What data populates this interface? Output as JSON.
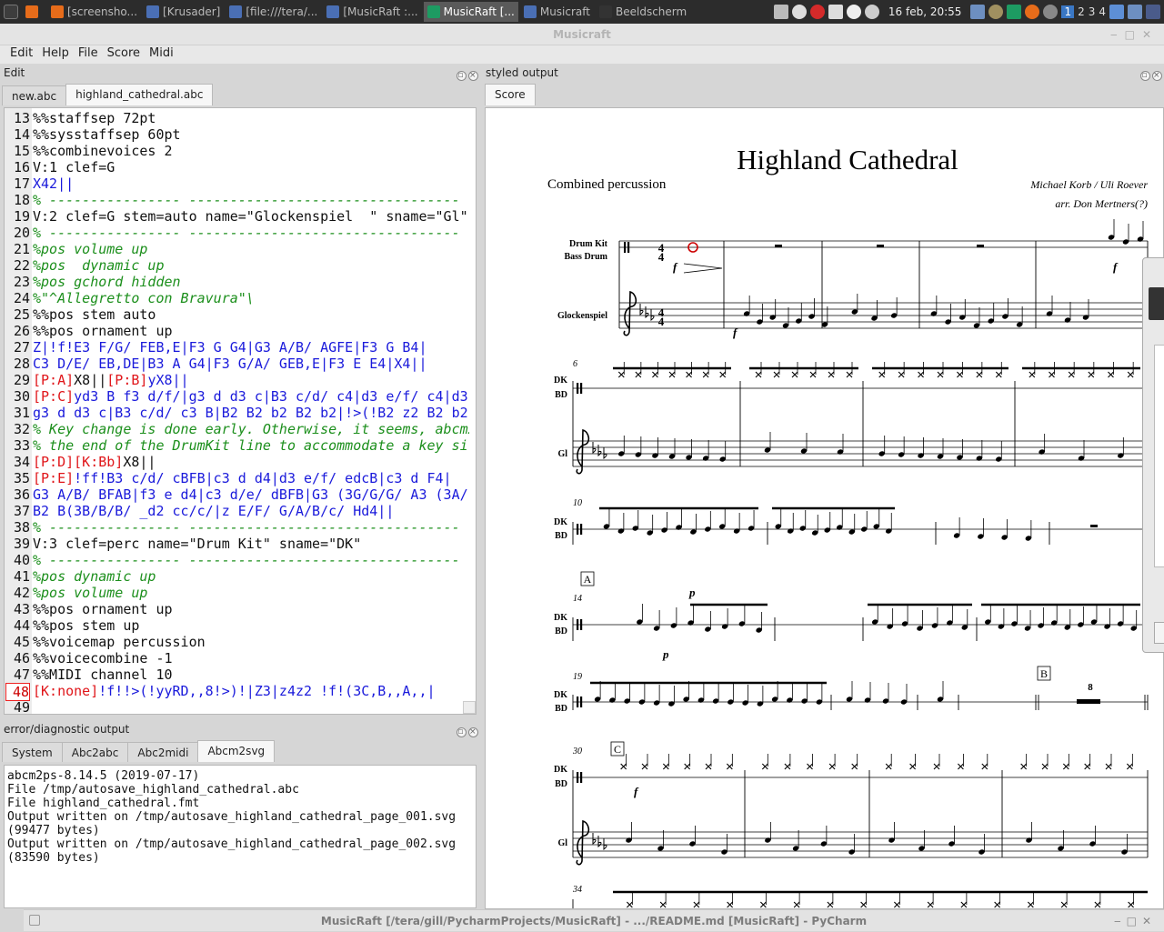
{
  "taskbar": {
    "tasks": [
      {
        "label": "",
        "color": "#e76c1a"
      },
      {
        "label": "[screensho...",
        "color": "#e76c1a"
      },
      {
        "label": "[Krusader]",
        "color": "#4a6fb5"
      },
      {
        "label": "[file:///tera/...",
        "color": "#4a6fb5"
      },
      {
        "label": "[MusicRaft :...",
        "color": "#4a6fb5"
      },
      {
        "label": "MusicRaft [...",
        "color": "#1d9b62",
        "active": true
      },
      {
        "label": "Musicraft",
        "color": "#4a6fb5"
      },
      {
        "label": "Beeldscherm",
        "color": "#333333"
      }
    ],
    "clock": "16 feb, 20:55",
    "workspaces": [
      "1",
      "2",
      "3",
      "4"
    ]
  },
  "window": {
    "title": "Musicraft"
  },
  "menu": [
    "Edit",
    "Help",
    "File",
    "Score",
    "Midi"
  ],
  "edit_dock": {
    "title": "Edit",
    "tabs": [
      "new.abc",
      "highland_cathedral.abc"
    ],
    "active_tab": 1,
    "current_line": "48",
    "lines": [
      {
        "n": "13",
        "segs": [
          {
            "t": "%%staffsep 72pt",
            "c": "plain"
          }
        ]
      },
      {
        "n": "14",
        "segs": [
          {
            "t": "%%sysstaffsep 60pt",
            "c": "plain"
          }
        ]
      },
      {
        "n": "15",
        "segs": [
          {
            "t": "%%combinevoices 2",
            "c": "plain"
          }
        ]
      },
      {
        "n": "16",
        "segs": [
          {
            "t": "V:1 clef=G",
            "c": "plain"
          }
        ]
      },
      {
        "n": "17",
        "segs": [
          {
            "t": "X42||",
            "c": "bar"
          }
        ]
      },
      {
        "n": "18",
        "segs": [
          {
            "t": "% ---------------- ---------------------------------",
            "c": "comment"
          }
        ]
      },
      {
        "n": "19",
        "segs": [
          {
            "t": "V:2 clef=G stem=auto name=\"Glockenspiel  \" sname=\"Gl\"",
            "c": "plain"
          }
        ]
      },
      {
        "n": "20",
        "segs": [
          {
            "t": "% ---------------- ---------------------------------",
            "c": "comment"
          }
        ]
      },
      {
        "n": "21",
        "segs": [
          {
            "t": "%pos volume up",
            "c": "comment"
          }
        ]
      },
      {
        "n": "22",
        "segs": [
          {
            "t": "%pos  dynamic up",
            "c": "comment"
          }
        ]
      },
      {
        "n": "23",
        "segs": [
          {
            "t": "%pos gchord hidden",
            "c": "comment"
          }
        ]
      },
      {
        "n": "24",
        "segs": [
          {
            "t": "%\"^Allegretto con Bravura\"\\",
            "c": "comment"
          }
        ]
      },
      {
        "n": "25",
        "segs": [
          {
            "t": "%%pos stem auto",
            "c": "plain"
          }
        ]
      },
      {
        "n": "26",
        "segs": [
          {
            "t": "%%pos ornament up",
            "c": "plain"
          }
        ]
      },
      {
        "n": "27",
        "segs": [
          {
            "t": "Z|!f!E3 F/G/ FEB,E|F3 G G4|G3 A/B/ AGFE|F3 G B4|",
            "c": "mixed"
          }
        ]
      },
      {
        "n": "28",
        "segs": [
          {
            "t": "C3 D/E/ EB,DE|B3 A G4|F3 G/A/ GEB,E|F3 E E4|X4||",
            "c": "mixed"
          }
        ]
      },
      {
        "n": "29",
        "segs": [
          {
            "t": "[P:A]",
            "c": "red"
          },
          {
            "t": "X8||",
            "c": "plain"
          },
          {
            "t": "[P:B]",
            "c": "red"
          },
          {
            "t": "yX8||",
            "c": "bar"
          }
        ]
      },
      {
        "n": "30",
        "segs": [
          {
            "t": "[P:C]",
            "c": "red"
          },
          {
            "t": "yd3 B f3 d/f/|g3 d d3 c|B3 c/d/ c4|d3 e/f/ c4|d3",
            "c": "mixed"
          }
        ]
      },
      {
        "n": "31",
        "segs": [
          {
            "t": "g3 d d3 c|B3 c/d/ c3 B|B2 B2 b2 B2 b2|!>(!B2 z2 B2 b2!>)",
            "c": "mixed"
          }
        ]
      },
      {
        "n": "32",
        "segs": [
          {
            "t": "% Key change is done early. Otherwise, it seems, abcm2",
            "c": "comment"
          }
        ]
      },
      {
        "n": "33",
        "segs": [
          {
            "t": "% the end of the DrumKit line to accommodate a key si",
            "c": "comment"
          }
        ]
      },
      {
        "n": "34",
        "segs": [
          {
            "t": "[P:D][K:Bb]",
            "c": "red"
          },
          {
            "t": "X8||",
            "c": "plain"
          }
        ]
      },
      {
        "n": "35",
        "segs": [
          {
            "t": "[P:E]",
            "c": "red"
          },
          {
            "t": "!ff!B3 c/d/ cBFB|c3 d d4|d3 e/f/ edcB|c3 d F4|",
            "c": "mixed"
          }
        ]
      },
      {
        "n": "36",
        "segs": [
          {
            "t": "G3 A/B/ BFAB|f3 e d4|c3 d/e/ dBFB|G3 (3G/G/G/ A3 (3A/",
            "c": "mixed"
          }
        ]
      },
      {
        "n": "37",
        "segs": [
          {
            "t": "B2 B(3B/B/B/ _d2 cc/c/|z E/F/ G/A/B/c/ Hd4||",
            "c": "mixed"
          }
        ]
      },
      {
        "n": "38",
        "segs": [
          {
            "t": "% ---------------- ---------------------------------",
            "c": "comment"
          }
        ]
      },
      {
        "n": "39",
        "segs": [
          {
            "t": "V:3 clef=perc name=\"Drum Kit\" sname=\"DK\"",
            "c": "plain"
          }
        ]
      },
      {
        "n": "40",
        "segs": [
          {
            "t": "% ---------------- ---------------------------------",
            "c": "comment"
          }
        ]
      },
      {
        "n": "41",
        "segs": [
          {
            "t": "%pos dynamic up",
            "c": "comment"
          }
        ]
      },
      {
        "n": "42",
        "segs": [
          {
            "t": "%pos volume up",
            "c": "comment"
          }
        ]
      },
      {
        "n": "43",
        "segs": [
          {
            "t": "%%pos ornament up",
            "c": "plain"
          }
        ]
      },
      {
        "n": "44",
        "segs": [
          {
            "t": "%%pos stem up",
            "c": "plain"
          }
        ]
      },
      {
        "n": "45",
        "segs": [
          {
            "t": "%%voicemap percussion",
            "c": "plain"
          }
        ]
      },
      {
        "n": "46",
        "segs": [
          {
            "t": "%%voicecombine -1",
            "c": "plain"
          }
        ]
      },
      {
        "n": "47",
        "segs": [
          {
            "t": "%%MIDI channel 10",
            "c": "plain"
          }
        ]
      },
      {
        "n": "48",
        "segs": [
          {
            "t": "[K:none]",
            "c": "red"
          },
          {
            "t": "!f!!>(!yyRD,,8!>)!|Z3|z4z2 !f!(3C,B,,A,,|",
            "c": "mixed"
          }
        ]
      },
      {
        "n": "49",
        "segs": [
          {
            "t": "",
            "c": "plain"
          }
        ]
      }
    ]
  },
  "diag_dock": {
    "title": "error/diagnostic output",
    "tabs": [
      "System",
      "Abc2abc",
      "Abc2midi",
      "Abcm2svg"
    ],
    "active_tab": 3,
    "output": "abcm2ps-8.14.5 (2019-07-17)\nFile /tmp/autosave_highland_cathedral.abc\nFile highland_cathedral.fmt\nOutput written on /tmp/autosave_highland_cathedral_page_001.svg\n(99477 bytes)\nOutput written on /tmp/autosave_highland_cathedral_page_002.svg\n(83590 bytes)"
  },
  "score_dock": {
    "title": "styled output",
    "tabs": [
      "Score"
    ],
    "score": {
      "title": "Highland Cathedral",
      "subtitle": "Combined percussion",
      "composer": "Michael Korb / Uli Roever",
      "arranger": "arr. Don Mertners(?)",
      "staff_labels": {
        "drum_kit": "Drum Kit",
        "bass_drum": "Bass Drum",
        "glockenspiel": "Glockenspiel",
        "dk": "DK",
        "bd": "BD",
        "gl": "Gl"
      },
      "measure_numbers": [
        "6",
        "10",
        "14",
        "19",
        "30",
        "34"
      ],
      "rehearsal_marks": [
        "A",
        "B",
        "C"
      ],
      "dynamics": [
        "f",
        "f",
        "f",
        "p",
        "p",
        "f"
      ],
      "multirest": "8",
      "time_sig": "4"
    }
  },
  "taskwin": {
    "title": "MusicRaft [/tera/gill/PycharmProjects/MusicRaft] - .../README.md [MusicRaft] - PyCharm"
  }
}
